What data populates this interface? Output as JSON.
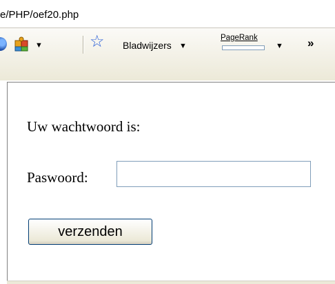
{
  "address_bar": {
    "url": "e/PHP/oef20.php"
  },
  "toolbar": {
    "bookmarks_label": "Bladwijzers",
    "pagerank_label": "PageRank",
    "pagerank_level": 0,
    "overflow_chevron": "»",
    "dropdown_arrow": "▼",
    "icons": [
      "firefox-globe-icon",
      "extensions-puzzle-icon",
      "bookmark-star-icon",
      "chevron-right-icon"
    ]
  },
  "page": {
    "password_message": "Uw wachtwoord is:",
    "password_label": "Paswoord:",
    "password_value": "",
    "submit_label": "verzenden"
  },
  "colors": {
    "star": "#2a5fd8",
    "input_border": "#7f9db9",
    "button_border": "#003c74",
    "toolbar_bg": "#ece9d8"
  }
}
